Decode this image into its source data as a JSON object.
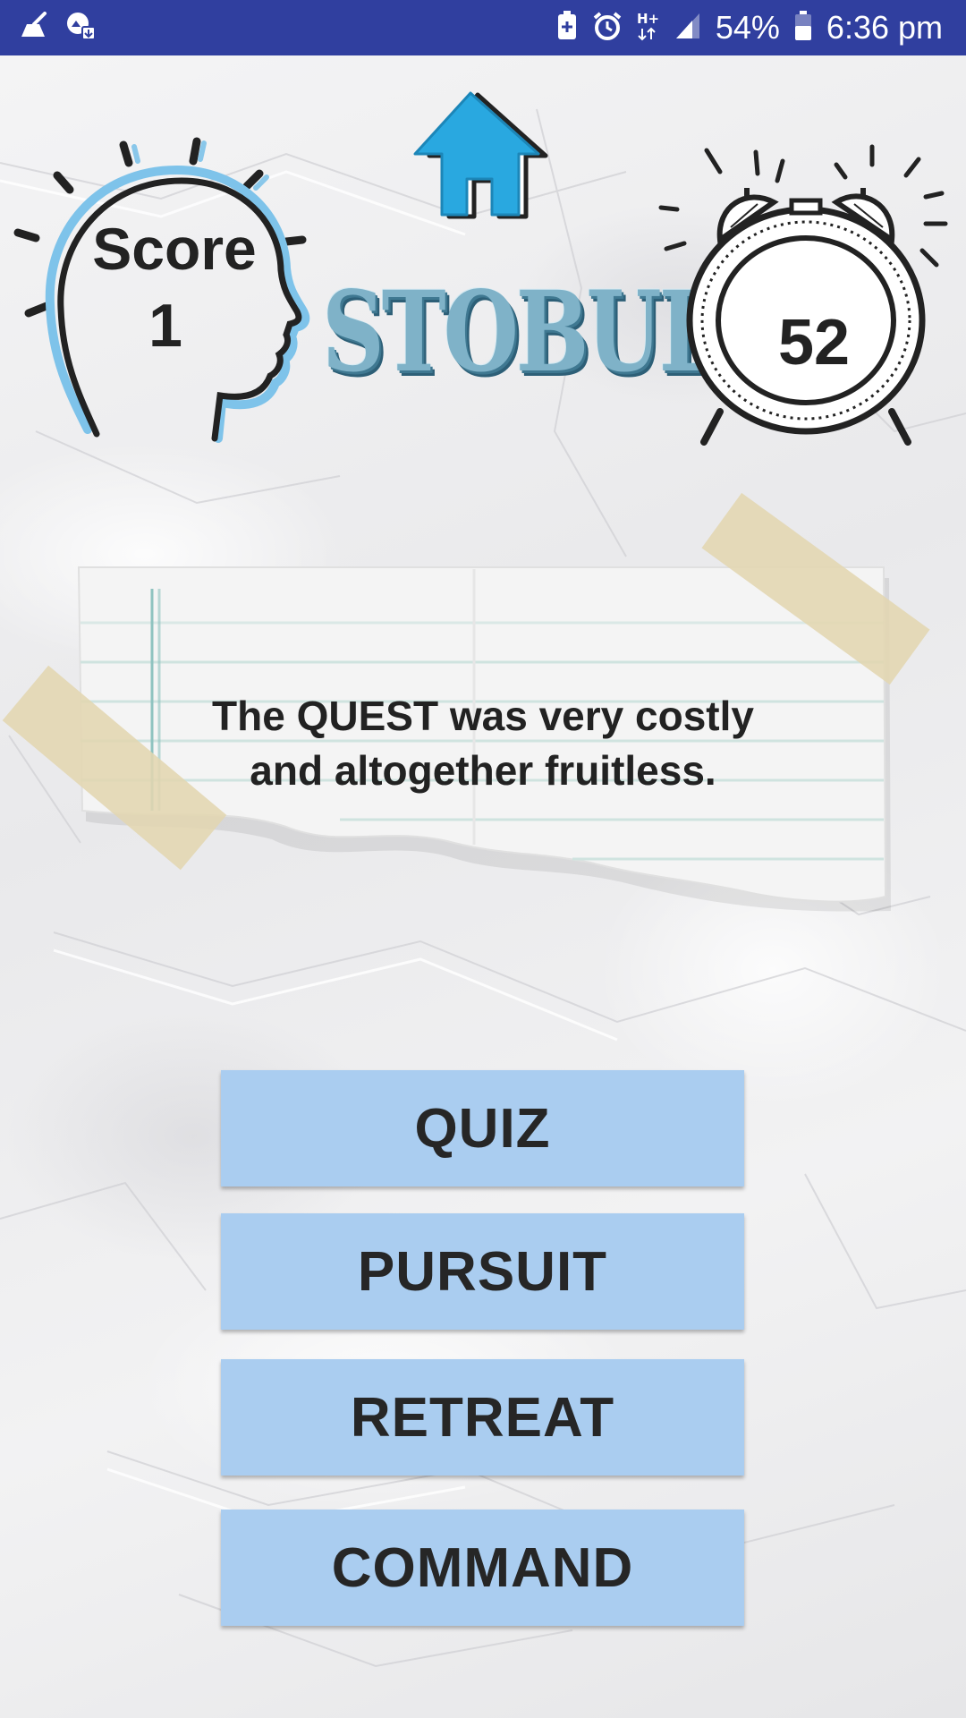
{
  "status_bar": {
    "battery": "54%",
    "time": "6:36 pm",
    "network": "H+",
    "bg_color": "#303f9f",
    "left_icons": [
      "cleaner-icon",
      "gallery-sync-icon"
    ],
    "right_icons": [
      "battery-saver-icon",
      "alarm-icon",
      "hplus-data-icon",
      "signal-icon",
      "battery-icon"
    ]
  },
  "header": {
    "score_label": "Score",
    "score_value": "1",
    "app_logo": "STOBULAR",
    "timer_value": "52",
    "home_icon": "home-icon",
    "accent_color": "#29a8e0"
  },
  "question": {
    "text": "The QUEST was very costly and altogether fruitless."
  },
  "answers": [
    {
      "label": "QUIZ"
    },
    {
      "label": "PURSUIT"
    },
    {
      "label": "RETREAT"
    },
    {
      "label": "COMMAND"
    }
  ],
  "colors": {
    "button_bg": "#aacdf0",
    "tape": "#e3d6b0"
  }
}
